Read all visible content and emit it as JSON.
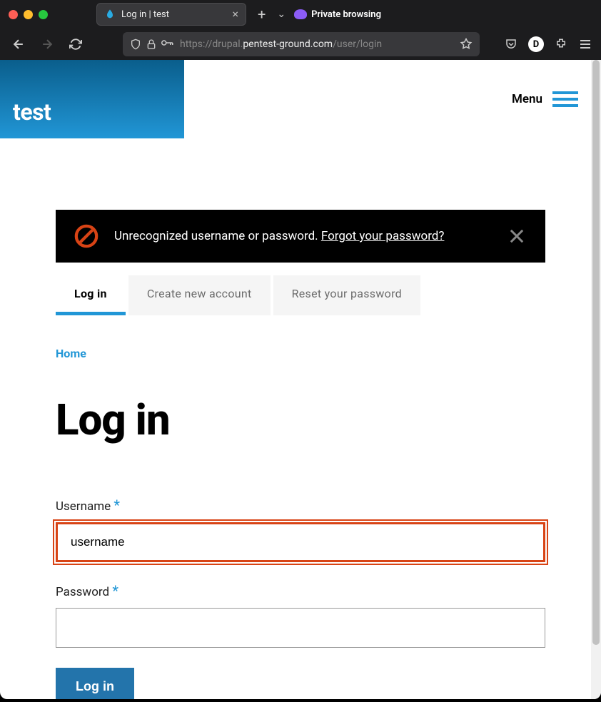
{
  "browser": {
    "tab_title": "Log in | test",
    "url_prefix": "https://drupal.",
    "url_domain": "pentest-ground.com",
    "url_path": "/user/login",
    "private_label": "Private browsing"
  },
  "site": {
    "name": "test",
    "menu_label": "Menu"
  },
  "alert": {
    "message": "Unrecognized username or password. ",
    "link_text": "Forgot your password?"
  },
  "tabs": [
    {
      "label": "Log in",
      "active": true
    },
    {
      "label": "Create new account",
      "active": false
    },
    {
      "label": "Reset your password",
      "active": false
    }
  ],
  "breadcrumb": {
    "home": "Home"
  },
  "page": {
    "title": "Log in"
  },
  "form": {
    "username_label": "Username ",
    "username_value": "username",
    "password_label": "Password ",
    "password_value": "",
    "submit_label": "Log in"
  }
}
